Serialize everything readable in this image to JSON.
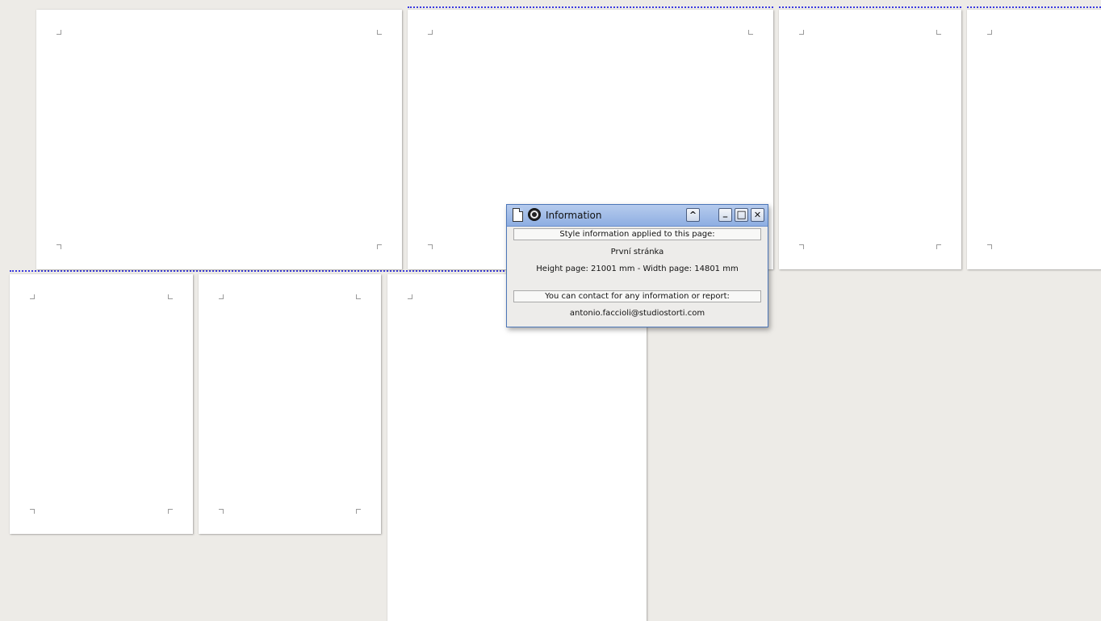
{
  "dialog": {
    "title": "Information",
    "section1_header": "Style information applied to this page:",
    "page_style_name": "První stránka",
    "page_dimensions": "Height page: 21001 mm - Width page: 14801 mm",
    "section2_header": "You can contact for any information or report:",
    "contact_email": "antonio.faccioli@studiostorti.com",
    "buttons": {
      "collapse": "^",
      "minimize": "_",
      "maximize": "□",
      "close": "✕"
    },
    "icons": [
      "document-icon",
      "settings-icon"
    ]
  },
  "colors": {
    "background": "#edebe7",
    "page": "#ffffff",
    "titlebar": "#9db9e8",
    "row_divider": "#3a3adf"
  }
}
